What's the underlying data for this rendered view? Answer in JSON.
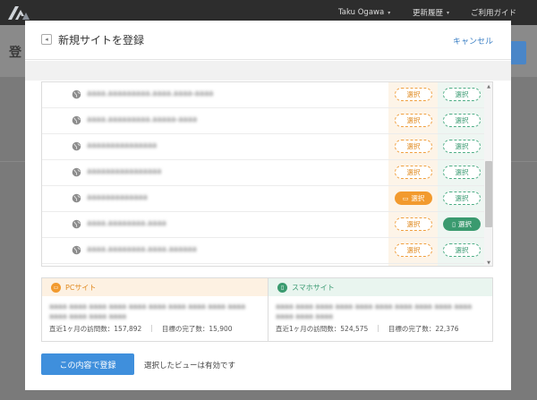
{
  "app": {
    "nav": [
      {
        "label": "Taku Ogawa",
        "caret": "▾"
      },
      {
        "label": "更新履歴",
        "caret": "▾"
      },
      {
        "label": "ご利用ガイド",
        "caret": ""
      }
    ],
    "background_title": "登"
  },
  "modal": {
    "title": "新規サイトを登録",
    "back_icon": "chevron-left-icon",
    "cancel_label": "キャンセル",
    "sites": [
      {
        "name": "aaaa.aaaaaaaaa.aaaa.aaaa-aaaa",
        "pc_label": "選択",
        "sp_label": "選択",
        "pc_selected": false,
        "sp_selected": false
      },
      {
        "name": "aaaa.aaaaaaaaa.aaaaa-aaaa",
        "pc_label": "選択",
        "sp_label": "選択",
        "pc_selected": false,
        "sp_selected": false
      },
      {
        "name": "aaaaaaaaaaaaaaa",
        "pc_label": "選択",
        "sp_label": "選択",
        "pc_selected": false,
        "sp_selected": false
      },
      {
        "name": "aaaaaaaaaaaaaaaa",
        "pc_label": "選択",
        "sp_label": "選択",
        "pc_selected": false,
        "sp_selected": false
      },
      {
        "name": "aaaaaaaaaaaaa",
        "pc_label": "選択",
        "sp_label": "選択",
        "pc_selected": true,
        "sp_selected": false
      },
      {
        "name": "aaaa.aaaaaaaa.aaaa",
        "pc_label": "選択",
        "sp_label": "選択",
        "pc_selected": false,
        "sp_selected": true
      },
      {
        "name": "aaaa.aaaaaaaa.aaaa.aaaaaa",
        "pc_label": "選択",
        "sp_label": "選択",
        "pc_selected": false,
        "sp_selected": false
      }
    ],
    "pc_panel": {
      "title": "PCサイト",
      "blurred": "aaaa aaaa aaaa aaaa aaaa aaaa aaaa aaaa aaaa aaaa aaaa aaaa aaaa aaaa",
      "visits_label": "直近1ヶ月の訪問数：157,892",
      "goals_label": "目標の完了数：15,900"
    },
    "sp_panel": {
      "title": "スマホサイト",
      "blurred": "aaaa aaaa aaaa aaaa aaaa aaaa aaaa aaaa aaaa aaaa aaaa aaaa aaaa",
      "visits_label": "直近1ヶ月の訪問数：524,575",
      "goals_label": "目標の完了数：22,376"
    },
    "submit_label": "この内容で登録",
    "footer_note": "選択したビューは有効です"
  },
  "colors": {
    "pc_accent": "#f29a2e",
    "sp_accent": "#3a9a6f",
    "primary_button": "#3f8fdc",
    "link": "#3b7fc4"
  }
}
